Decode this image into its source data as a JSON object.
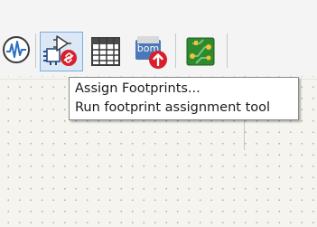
{
  "toolbar": {
    "buttons": [
      {
        "name": "simulator",
        "icon": "waveform-icon"
      },
      {
        "name": "assign-footprints",
        "icon": "footprint-assignment-icon",
        "active": true
      },
      {
        "name": "symbol-fields-table",
        "icon": "table-icon"
      },
      {
        "name": "generate-bom",
        "icon": "bom-icon",
        "icon_text": "bom"
      },
      {
        "name": "open-pcb-editor",
        "icon": "pcb-icon"
      }
    ]
  },
  "tooltip": {
    "title": "Assign Footprints...",
    "description": "Run footprint assignment tool"
  },
  "colors": {
    "toolbar_bg": "#f4f4f4",
    "canvas_bg": "#f5f4ef",
    "active_button_bg": "#dce8f6",
    "active_button_border": "#78aee0",
    "badge_red": "#d8202a",
    "pcb_green": "#2f8a2f",
    "bom_blue": "#4a78b8"
  }
}
